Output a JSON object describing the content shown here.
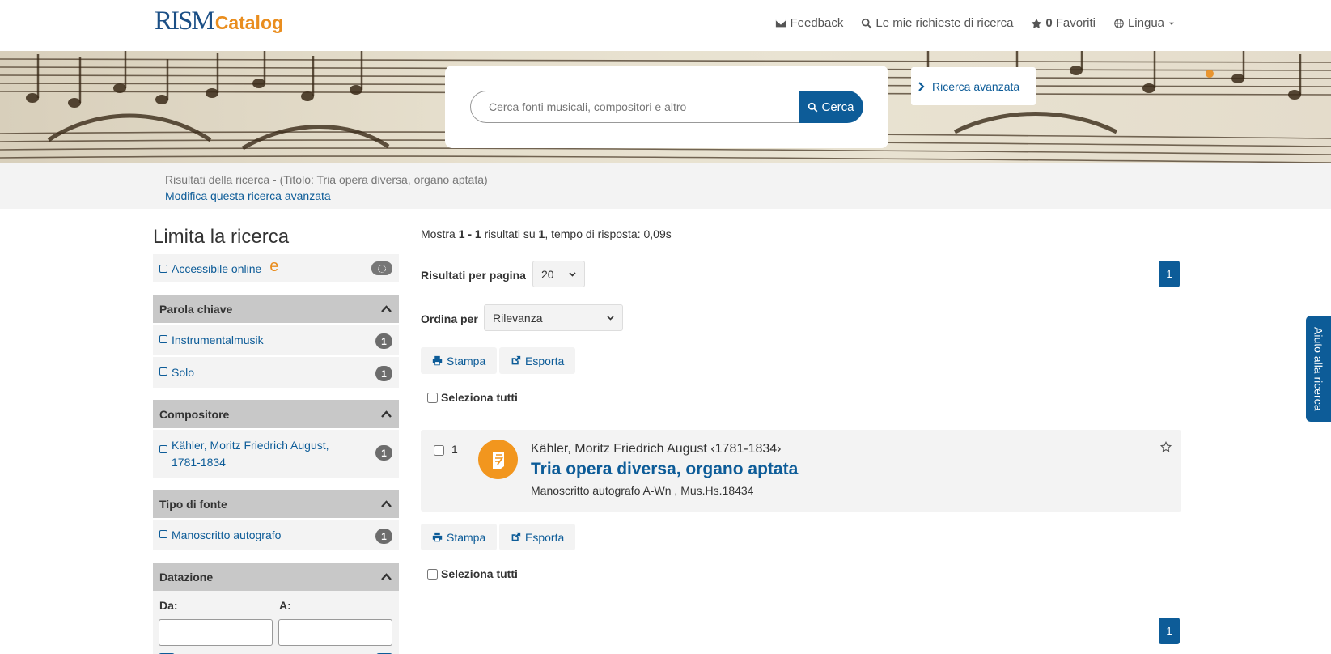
{
  "logo": {
    "rism": "RISM",
    "catalog": "Catalog"
  },
  "nav": {
    "feedback": "Feedback",
    "searches": "Le mie richieste di ricerca",
    "favorites_count": "0",
    "favorites": "Favoriti",
    "language": "Lingua"
  },
  "search": {
    "placeholder": "Cerca fonti musicali, compositori e altro",
    "button": "Cerca",
    "advanced": "Ricerca avanzata"
  },
  "query": {
    "summary": "Risultati della ricerca - (Titolo: Tria opera diversa, organo aptata)",
    "modify": "Modifica questa ricerca avanzata"
  },
  "sidebar": {
    "title": "Limita la ricerca",
    "online_label": "Accessibile online",
    "online_badge": "e",
    "facets": [
      {
        "title": "Parola chiave",
        "items": [
          {
            "label": "Instrumentalmusik",
            "count": "1"
          },
          {
            "label": "Solo",
            "count": "1"
          }
        ]
      },
      {
        "title": "Compositore",
        "items": [
          {
            "label": "Kähler, Moritz Friedrich August, 1781-1834",
            "count": "1"
          }
        ]
      },
      {
        "title": "Tipo di fonte",
        "items": [
          {
            "label": "Manoscritto autografo",
            "count": "1"
          }
        ]
      }
    ],
    "dating": {
      "title": "Datazione",
      "from": "Da:",
      "to": "A:"
    }
  },
  "results": {
    "stats": {
      "prefix": "Mostra ",
      "range": "1 - 1",
      "mid": " risultati su ",
      "total": "1",
      "suffix": ", tempo di risposta: 0,09s"
    },
    "per_page_label": "Risultati per pagina",
    "per_page_value": "20",
    "sort_label": "Ordina per",
    "sort_value": "Rilevanza",
    "page": "1",
    "print": "Stampa",
    "export": "Esporta",
    "select_all": "Seleziona tutti",
    "items": [
      {
        "num": "1",
        "composer": "Kähler, Moritz Friedrich August ‹1781-1834›",
        "title": "Tria opera diversa, organo aptata",
        "shelfmark": "Manoscritto autografo A-Wn , Mus.Hs.18434"
      }
    ]
  },
  "help_tab": "Aiuto alla ricerca",
  "colors": {
    "primary": "#0d5c98",
    "accent": "#e98d1e",
    "icon_bg": "#f2961e"
  }
}
